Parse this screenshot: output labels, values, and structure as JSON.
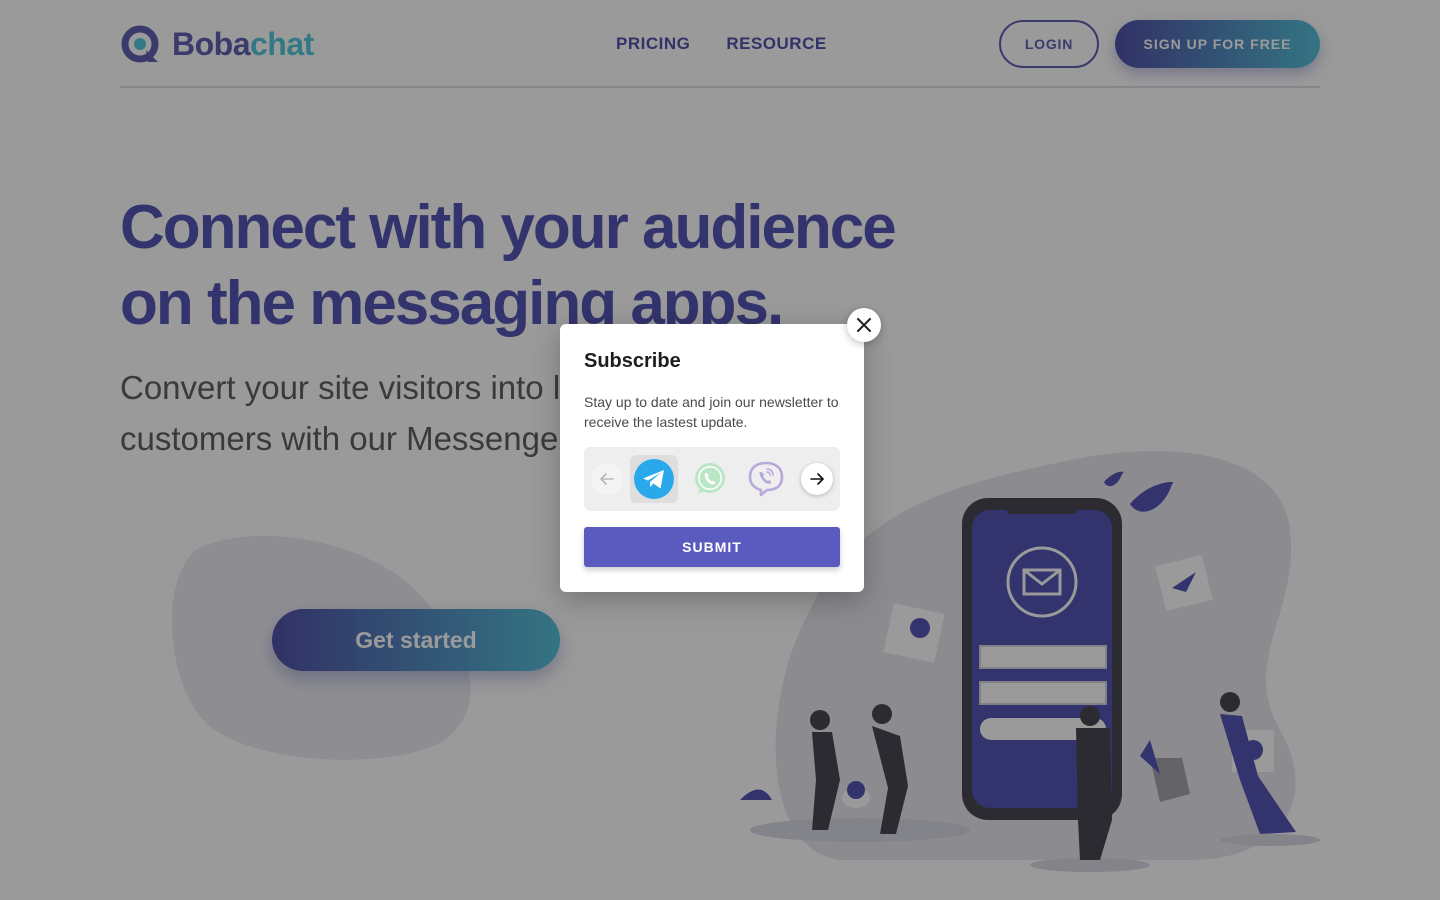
{
  "header": {
    "logo_part1": "Boba",
    "logo_part2": "chat",
    "nav": [
      {
        "label": "PRICING"
      },
      {
        "label": "RESOURCE"
      }
    ],
    "login_label": "LOGIN",
    "signup_label": "SIGN UP FOR FREE"
  },
  "hero": {
    "title_line1": "Connect with your audience",
    "title_line2": "on the messaging apps.",
    "subtitle_line1": "Convert your site visitors into lifelong",
    "subtitle_line2": "customers with our Messenger platform.",
    "cta_label": "Get started"
  },
  "modal": {
    "title": "Subscribe",
    "description": "Stay up to date and join our newsletter to receive the lastest update.",
    "apps": [
      {
        "icon": "telegram-icon",
        "selected": true
      },
      {
        "icon": "whatsapp-icon",
        "selected": false
      },
      {
        "icon": "viber-icon",
        "selected": false
      }
    ],
    "submit_label": "SUBMIT"
  },
  "colors": {
    "brand_indigo": "#3d3dab",
    "brand_cyan": "#3fb8d4",
    "submit": "#5b5bbf",
    "overlay": "rgba(40,40,40,0.47)"
  }
}
